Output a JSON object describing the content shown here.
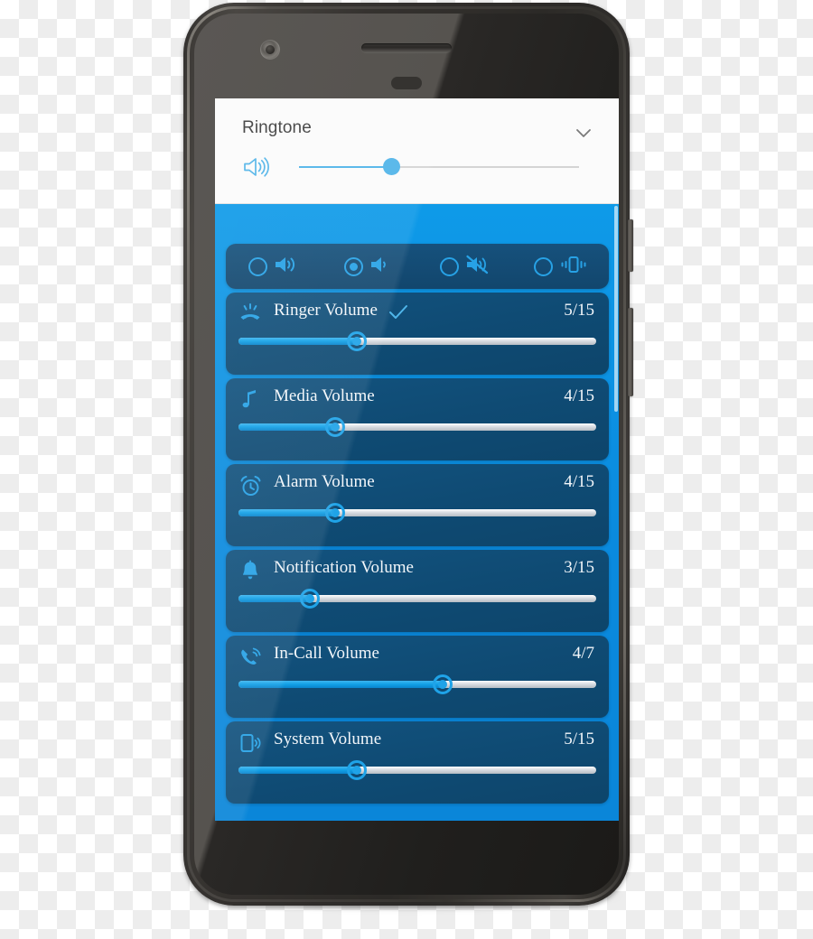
{
  "device": {
    "name": "smartphone-mockup",
    "hardware": {
      "front_camera": "front-camera",
      "earpiece": "earpiece-speaker",
      "proximity_sensor": "proximity-sensor",
      "power_button": "power-button",
      "volume_rocker": "volume-rocker"
    }
  },
  "ringtone_panel": {
    "title": "Ringtone",
    "expand_icon": "chevron-down-icon",
    "speaker_icon": "speaker-loud-icon",
    "slider": {
      "percent": 33,
      "fill_color": "#4fb3e8",
      "track_color": "#d4d4d4"
    }
  },
  "ringer_modes": {
    "selected_index": 1,
    "options": [
      {
        "id": "mode-loud",
        "icon": "speaker-loud-icon",
        "selected": false
      },
      {
        "id": "mode-medium",
        "icon": "speaker-low-icon",
        "selected": true
      },
      {
        "id": "mode-silent",
        "icon": "speaker-muted-icon",
        "selected": false
      },
      {
        "id": "mode-vibrate",
        "icon": "vibrate-icon",
        "selected": false
      }
    ]
  },
  "volume_rows": [
    {
      "id": "ringer-volume",
      "label": "Ringer Volume",
      "icon": "phone-ringing-icon",
      "value": 5,
      "max": 15,
      "value_text": "5/15",
      "percent": 33,
      "checked": true,
      "check_icon": "check-icon"
    },
    {
      "id": "media-volume",
      "label": "Media Volume",
      "icon": "music-note-icon",
      "value": 4,
      "max": 15,
      "value_text": "4/15",
      "percent": 27,
      "checked": false,
      "check_icon": ""
    },
    {
      "id": "alarm-volume",
      "label": "Alarm Volume",
      "icon": "alarm-clock-icon",
      "value": 4,
      "max": 15,
      "value_text": "4/15",
      "percent": 27,
      "checked": false,
      "check_icon": ""
    },
    {
      "id": "notification-volume",
      "label": "Notification Volume",
      "icon": "bell-icon",
      "value": 3,
      "max": 15,
      "value_text": "3/15",
      "percent": 20,
      "checked": false,
      "check_icon": ""
    },
    {
      "id": "in-call-volume",
      "label": "In-Call Volume",
      "icon": "phone-call-icon",
      "value": 4,
      "max": 7,
      "value_text": "4/7",
      "percent": 57,
      "checked": false,
      "check_icon": ""
    },
    {
      "id": "system-volume",
      "label": "System Volume",
      "icon": "phone-sound-icon",
      "value": 5,
      "max": 15,
      "value_text": "5/15",
      "percent": 33,
      "checked": false,
      "check_icon": ""
    }
  ],
  "colors": {
    "app_background_blue": "#0a8ade",
    "card_blue": "#0f4b74",
    "accent_blue": "#1fa3e8",
    "panel_white": "#fbfbfb",
    "text_light": "#f2f6fa",
    "title_gray": "#3c3c3c"
  }
}
